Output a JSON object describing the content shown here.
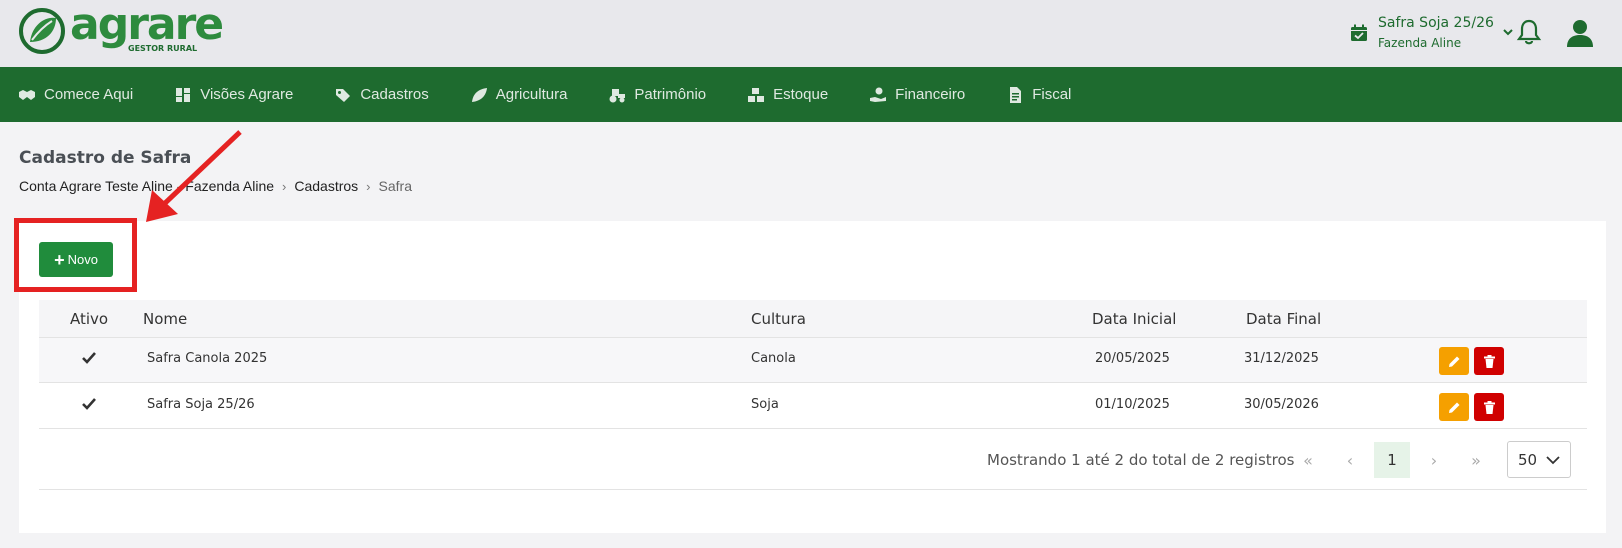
{
  "brand": {
    "name": "agrare",
    "tagline": "GESTOR RURAL",
    "primary_color": "#1e6b2f",
    "logo_icon": "leaf-logo-icon"
  },
  "header": {
    "safra_title": "Safra Soja 25/26",
    "safra_sub": "Fazenda Aline",
    "icons": [
      "calendar-check-icon",
      "chevron-down-icon",
      "bell-icon",
      "user-icon"
    ]
  },
  "nav": {
    "items": [
      {
        "label": "Comece Aqui",
        "icon": "handshake-icon"
      },
      {
        "label": "Visões Agrare",
        "icon": "dashboard-icon"
      },
      {
        "label": "Cadastros",
        "icon": "tags-icon"
      },
      {
        "label": "Agricultura",
        "icon": "leaf-icon"
      },
      {
        "label": "Patrimônio",
        "icon": "tractor-icon"
      },
      {
        "label": "Estoque",
        "icon": "boxes-icon"
      },
      {
        "label": "Financeiro",
        "icon": "hand-dollar-icon"
      },
      {
        "label": "Fiscal",
        "icon": "file-invoice-icon"
      }
    ]
  },
  "page": {
    "title": "Cadastro de Safra",
    "breadcrumb": [
      "Conta Agrare Teste Aline - Fazenda Aline",
      "Cadastros",
      "Safra"
    ]
  },
  "toolbar": {
    "new_label": "Novo"
  },
  "table": {
    "columns": [
      "Ativo",
      "Nome",
      "Cultura",
      "Data Inicial",
      "Data Final"
    ],
    "rows": [
      {
        "ativo": true,
        "nome": "Safra Canola 2025",
        "cultura": "Canola",
        "data_inicial": "20/05/2025",
        "data_final": "31/12/2025"
      },
      {
        "ativo": true,
        "nome": "Safra Soja 25/26",
        "cultura": "Soja",
        "data_inicial": "01/10/2025",
        "data_final": "30/05/2026"
      }
    ],
    "action_colors": {
      "edit": "#f5a000",
      "delete": "#d00000"
    }
  },
  "pagination": {
    "summary": "Mostrando 1 até 2 do total de 2 registros",
    "current_page": "1",
    "page_size": "50"
  },
  "annotation": {
    "color": "#e52222",
    "target": "Novo button highlighted with red box and arrow"
  }
}
